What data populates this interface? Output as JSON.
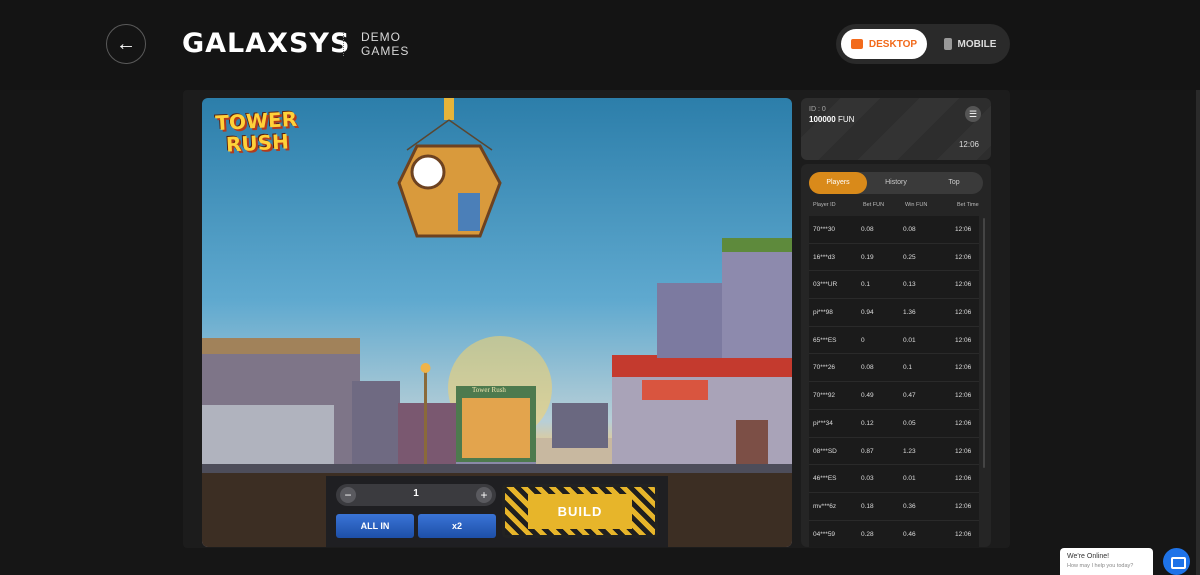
{
  "header": {
    "back_icon": "arrow-left-icon",
    "brand": "GALAXSYS",
    "demo_line1": "DEMO",
    "demo_line2": "GAMES",
    "mode_desktop": "DESKTOP",
    "mode_mobile": "MOBILE",
    "active_mode": "DESKTOP"
  },
  "game": {
    "logo_line1": "TOWER",
    "logo_line2": "RUSH",
    "shop_sign": "Tower Rush",
    "bet_value": "1",
    "minus_label": "−",
    "plus_label": "+",
    "all_in_label": "ALL IN",
    "x2_label": "x2",
    "build_label": "BUILD"
  },
  "account": {
    "id": "ID : 0",
    "balance": "100000",
    "currency": "FUN",
    "time": "12:06",
    "menu_icon": "hamburger-icon"
  },
  "bets": {
    "tabs": [
      "Players",
      "History",
      "Top"
    ],
    "active_tab": "Players",
    "columns": [
      "Player ID",
      "Bet FUN",
      "Win FUN",
      "Bet Time"
    ],
    "rows": [
      [
        "70***30",
        "0.08",
        "0.08",
        "12:06"
      ],
      [
        "16***d3",
        "0.19",
        "0.25",
        "12:06"
      ],
      [
        "03***UR",
        "0.1",
        "0.13",
        "12:06"
      ],
      [
        "pi***98",
        "0.94",
        "1.36",
        "12:06"
      ],
      [
        "65***ES",
        "0",
        "0.01",
        "12:06"
      ],
      [
        "70***26",
        "0.08",
        "0.1",
        "12:06"
      ],
      [
        "70***92",
        "0.49",
        "0.47",
        "12:06"
      ],
      [
        "pi***34",
        "0.12",
        "0.05",
        "12:06"
      ],
      [
        "08***SD",
        "0.87",
        "1.23",
        "12:06"
      ],
      [
        "46***ES",
        "0.03",
        "0.01",
        "12:06"
      ],
      [
        "mv***6z",
        "0.18",
        "0.36",
        "12:06"
      ],
      [
        "04***59",
        "0.28",
        "0.46",
        "12:06"
      ]
    ]
  },
  "chat": {
    "title": "We're Online!",
    "subtitle": "How may I help you today?",
    "icon": "chat-icon"
  },
  "colors": {
    "accent": "#f26a1b",
    "tab_active": "#d98a1a",
    "build_yellow": "#e7b52a",
    "action_blue": "#2a62c2",
    "chat_blue": "#1e73e8"
  }
}
